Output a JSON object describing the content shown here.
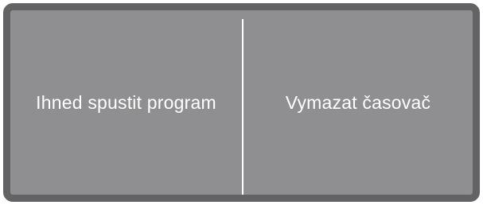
{
  "panel": {
    "options": [
      {
        "label": "Ihned spustit program"
      },
      {
        "label": "Vymazat časovač"
      }
    ]
  },
  "colors": {
    "border": "#636365",
    "background": "#8f8f91",
    "text": "#ffffff",
    "divider": "#ffffff"
  }
}
